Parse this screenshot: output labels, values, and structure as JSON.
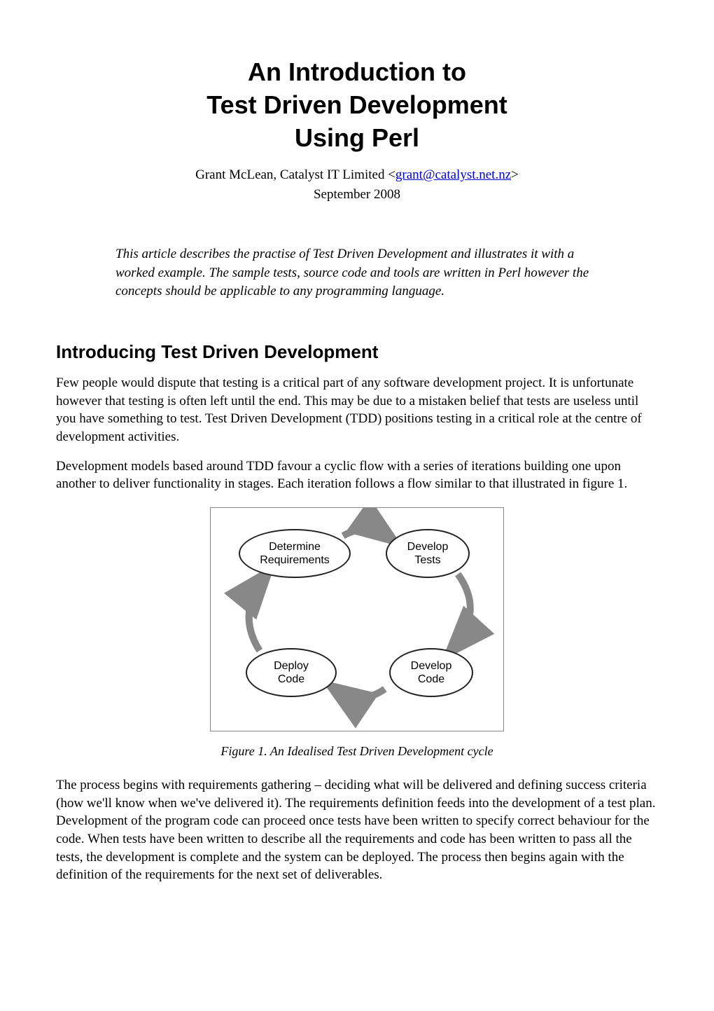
{
  "title": {
    "line1": "An Introduction to",
    "line2": "Test Driven Development",
    "line3": "Using Perl"
  },
  "byline": {
    "prefix": "Grant McLean, Catalyst IT Limited <",
    "email": "grant@catalyst.net.nz",
    "suffix": ">"
  },
  "date": "September 2008",
  "abstract": "This article describes the practise of Test Driven Development and illustrates it with a worked example. The sample tests, source code and tools are written in Perl however the concepts should be applicable to any programming language.",
  "section_heading": "Introducing Test Driven Development",
  "paragraphs": {
    "p1": "Few people would dispute that testing is a critical part of any software development project. It is unfortunate however that testing is often left until the end. This may be due to a mistaken belief that tests are useless until you have something to test. Test Driven Development (TDD) positions testing in a critical role at the centre of development activities.",
    "p2": "Development models based around TDD favour a cyclic flow with a series of iterations building one upon another to deliver functionality in stages. Each iteration follows a flow similar to that illustrated in figure 1.",
    "p3": "The process begins with requirements gathering – deciding what will be delivered and defining success criteria (how we'll know when we've delivered it). The requirements definition feeds into the development of a test plan. Development of the program code can proceed once tests have been written to specify correct behaviour for the code. When tests have been written to describe all the requirements and code has been written to pass all the tests, the development is complete and the system can be deployed. The process then begins again with the definition of the requirements for the next set of deliverables."
  },
  "figure": {
    "caption": "Figure 1. An Idealised Test Driven Development cycle",
    "nodes": {
      "top_left": "Determine\nRequirements",
      "top_right": "Develop\nTests",
      "bottom_left": "Deploy\nCode",
      "bottom_right": "Develop\nCode"
    }
  }
}
